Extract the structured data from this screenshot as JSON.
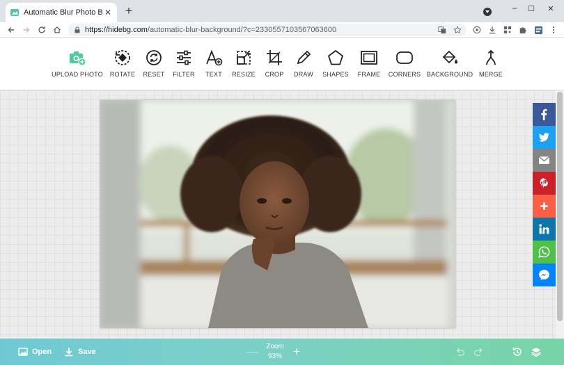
{
  "browser": {
    "tab_title": "Automatic Blur Photo Backgrou",
    "tab_close": "✕",
    "new_tab": "+",
    "url_host": "https://hidebg.com",
    "url_path": "/automatic-blur-background/?c=2330557103567063600",
    "window_controls": [
      "–",
      "☐",
      "✕"
    ]
  },
  "tools": [
    {
      "label": "UPLOAD PHOTO",
      "icon": "camera-plus-icon"
    },
    {
      "label": "ROTATE",
      "icon": "rotate-icon"
    },
    {
      "label": "RESET",
      "icon": "reset-icon"
    },
    {
      "label": "FILTER",
      "icon": "sliders-icon"
    },
    {
      "label": "TEXT",
      "icon": "text-plus-icon"
    },
    {
      "label": "RESIZE",
      "icon": "resize-icon"
    },
    {
      "label": "CROP",
      "icon": "crop-icon"
    },
    {
      "label": "DRAW",
      "icon": "pencil-icon"
    },
    {
      "label": "SHAPES",
      "icon": "pentagon-icon"
    },
    {
      "label": "FRAME",
      "icon": "frame-icon"
    },
    {
      "label": "CORNERS",
      "icon": "rounded-rect-icon"
    },
    {
      "label": "BACKGROUND",
      "icon": "paint-bucket-icon"
    },
    {
      "label": "MERGE",
      "icon": "merge-icon"
    }
  ],
  "share": [
    {
      "name": "facebook",
      "color": "#3b5998"
    },
    {
      "name": "twitter",
      "color": "#1da1f2"
    },
    {
      "name": "email",
      "color": "#848484"
    },
    {
      "name": "pinterest",
      "color": "#cb2027"
    },
    {
      "name": "more",
      "color": "#fa5f45"
    },
    {
      "name": "linkedin",
      "color": "#0e76a8"
    },
    {
      "name": "whatsapp",
      "color": "#4dc247"
    },
    {
      "name": "messenger",
      "color": "#0084ff"
    }
  ],
  "bottom": {
    "open_label": "Open",
    "save_label": "Save",
    "zoom_label": "Zoom",
    "zoom_value": "93%",
    "zoom_out": "—",
    "zoom_in": "+"
  },
  "colors": {
    "accent": "#4ecb9e",
    "bottom_gradient_start": "#6fc9d4",
    "bottom_gradient_end": "#77d4a6"
  }
}
